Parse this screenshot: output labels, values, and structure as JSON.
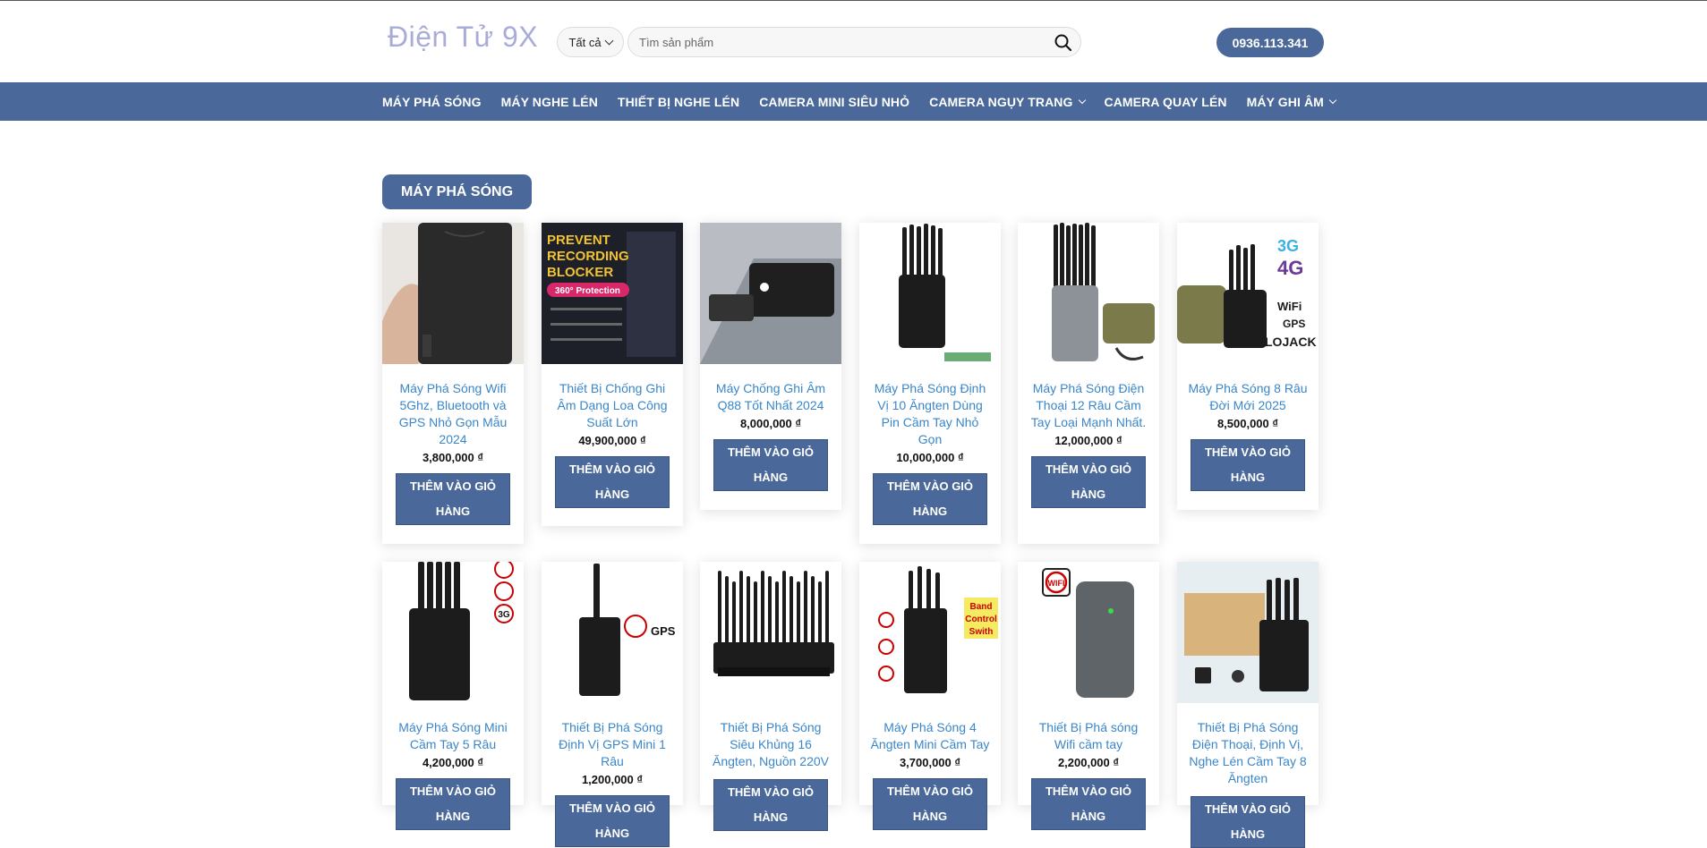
{
  "header": {
    "logo": "Điện Tử 9X",
    "category_select": "Tất cả",
    "search_placeholder": "Tìm sản phẩm",
    "phone": "0936.113.341"
  },
  "nav": [
    {
      "label": "MÁY PHÁ SÓNG",
      "dropdown": false
    },
    {
      "label": "MÁY NGHE LÉN",
      "dropdown": false
    },
    {
      "label": "THIẾT BỊ NGHE LÉN",
      "dropdown": false
    },
    {
      "label": "CAMERA MINI SIÊU NHỎ",
      "dropdown": false
    },
    {
      "label": "CAMERA NGỤY TRANG",
      "dropdown": true
    },
    {
      "label": "CAMERA QUAY LÉN",
      "dropdown": false
    },
    {
      "label": "MÁY GHI ÂM",
      "dropdown": true
    }
  ],
  "section": {
    "title": "MÁY PHÁ SÓNG"
  },
  "cart_label": "THÊM VÀO GIỎ HÀNG",
  "products": [
    {
      "name": "Máy Phá Sóng Wifi 5Ghz, Bluetooth và GPS Nhỏ Gọn Mẫu 2024",
      "price": "3,800,000 ₫"
    },
    {
      "name": "Thiết Bị Chống Ghi Âm Dạng Loa Công Suất Lớn",
      "price": "49,900,000 ₫",
      "image_text": [
        "PREVENT",
        "RECORDING",
        "BLOCKER",
        "360° Protection"
      ]
    },
    {
      "name": "Máy Chống Ghi Âm Q88 Tốt Nhất 2024",
      "price": "8,000,000 ₫"
    },
    {
      "name": "Máy Phá Sóng Định Vị 10 Ăngten Dùng Pin Cầm Tay Nhỏ Gọn",
      "price": "10,000,000 ₫"
    },
    {
      "name": "Máy Phá Sóng Điện Thoại 12 Râu Cầm Tay Loại Mạnh Nhất.",
      "price": "12,000,000 ₫"
    },
    {
      "name": "Máy Phá Sóng 8 Râu Đời Mới 2025",
      "price": "8,500,000 ₫",
      "image_text": [
        "3G",
        "4G",
        "WiFi",
        "GPS",
        "LOJACK"
      ]
    },
    {
      "name": "Máy Phá Sóng Mini Cầm Tay 5 Râu",
      "price": "4,200,000 ₫",
      "image_text": [
        "3G"
      ]
    },
    {
      "name": "Thiết Bị Phá Sóng Định Vị GPS Mini 1 Râu",
      "price": "1,200,000 ₫",
      "image_text": [
        "GPS"
      ]
    },
    {
      "name": "Thiết Bị Phá Sóng Siêu Khủng 16 Ăngten, Nguồn 220V",
      "price": ""
    },
    {
      "name": "Máy Phá Sóng 4 Ăngten Mini Cầm Tay",
      "price": "3,700,000 ₫",
      "image_text": [
        "Band",
        "Control",
        "Swith"
      ]
    },
    {
      "name": "Thiết Bị Phá sóng Wifi cầm tay",
      "price": "2,200,000 ₫",
      "image_text": [
        "WIFI"
      ]
    },
    {
      "name": "Thiết Bị Phá Sóng Điện Thoại, Định Vị, Nghe Lén Cầm Tay 8 Ăngten",
      "price": ""
    }
  ],
  "colors": {
    "brand": "#4a6899",
    "link": "#3a86c8",
    "logo": "#a8acd6"
  }
}
